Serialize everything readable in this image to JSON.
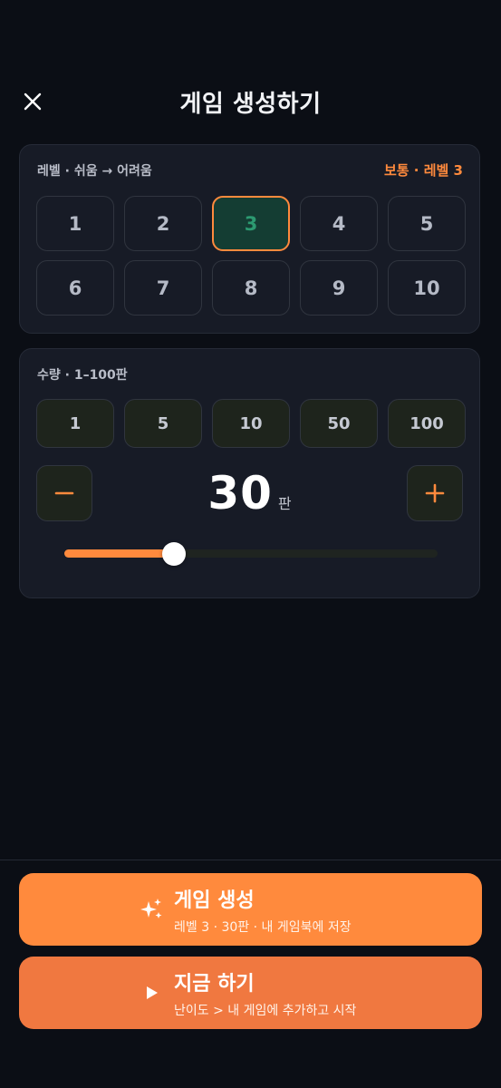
{
  "header": {
    "title": "게임 생성하기",
    "close_icon": "close-icon"
  },
  "level_card": {
    "label": "레벨 · 쉬움 → 어려움",
    "badge": "보통 · 레벨 3",
    "levels": [
      "1",
      "2",
      "3",
      "4",
      "5",
      "6",
      "7",
      "8",
      "9",
      "10"
    ],
    "selected": "3"
  },
  "quantity_card": {
    "label": "수량 · 1–100판",
    "presets": [
      "1",
      "5",
      "10",
      "50",
      "100"
    ],
    "minus_icon": "minus-icon",
    "plus_icon": "plus-icon",
    "value": "30",
    "unit": "판",
    "min": 1,
    "max": 100,
    "slider_value": 30
  },
  "actions": {
    "create": {
      "title": "게임 생성",
      "subtitle": "레벨 3 · 30판 · 내 게임북에 저장",
      "icon": "sparkle-icon"
    },
    "play": {
      "title": "지금 하기",
      "subtitle": "난이도 > 내 게임에 추가하고 시작",
      "icon": "play-icon"
    }
  },
  "colors": {
    "accent": "#ff8a3d",
    "accent_alt": "#f07840",
    "selected_bg": "#143d33",
    "selected_text": "#2c9a71",
    "background": "#0b0e15",
    "card": "#171b26"
  }
}
